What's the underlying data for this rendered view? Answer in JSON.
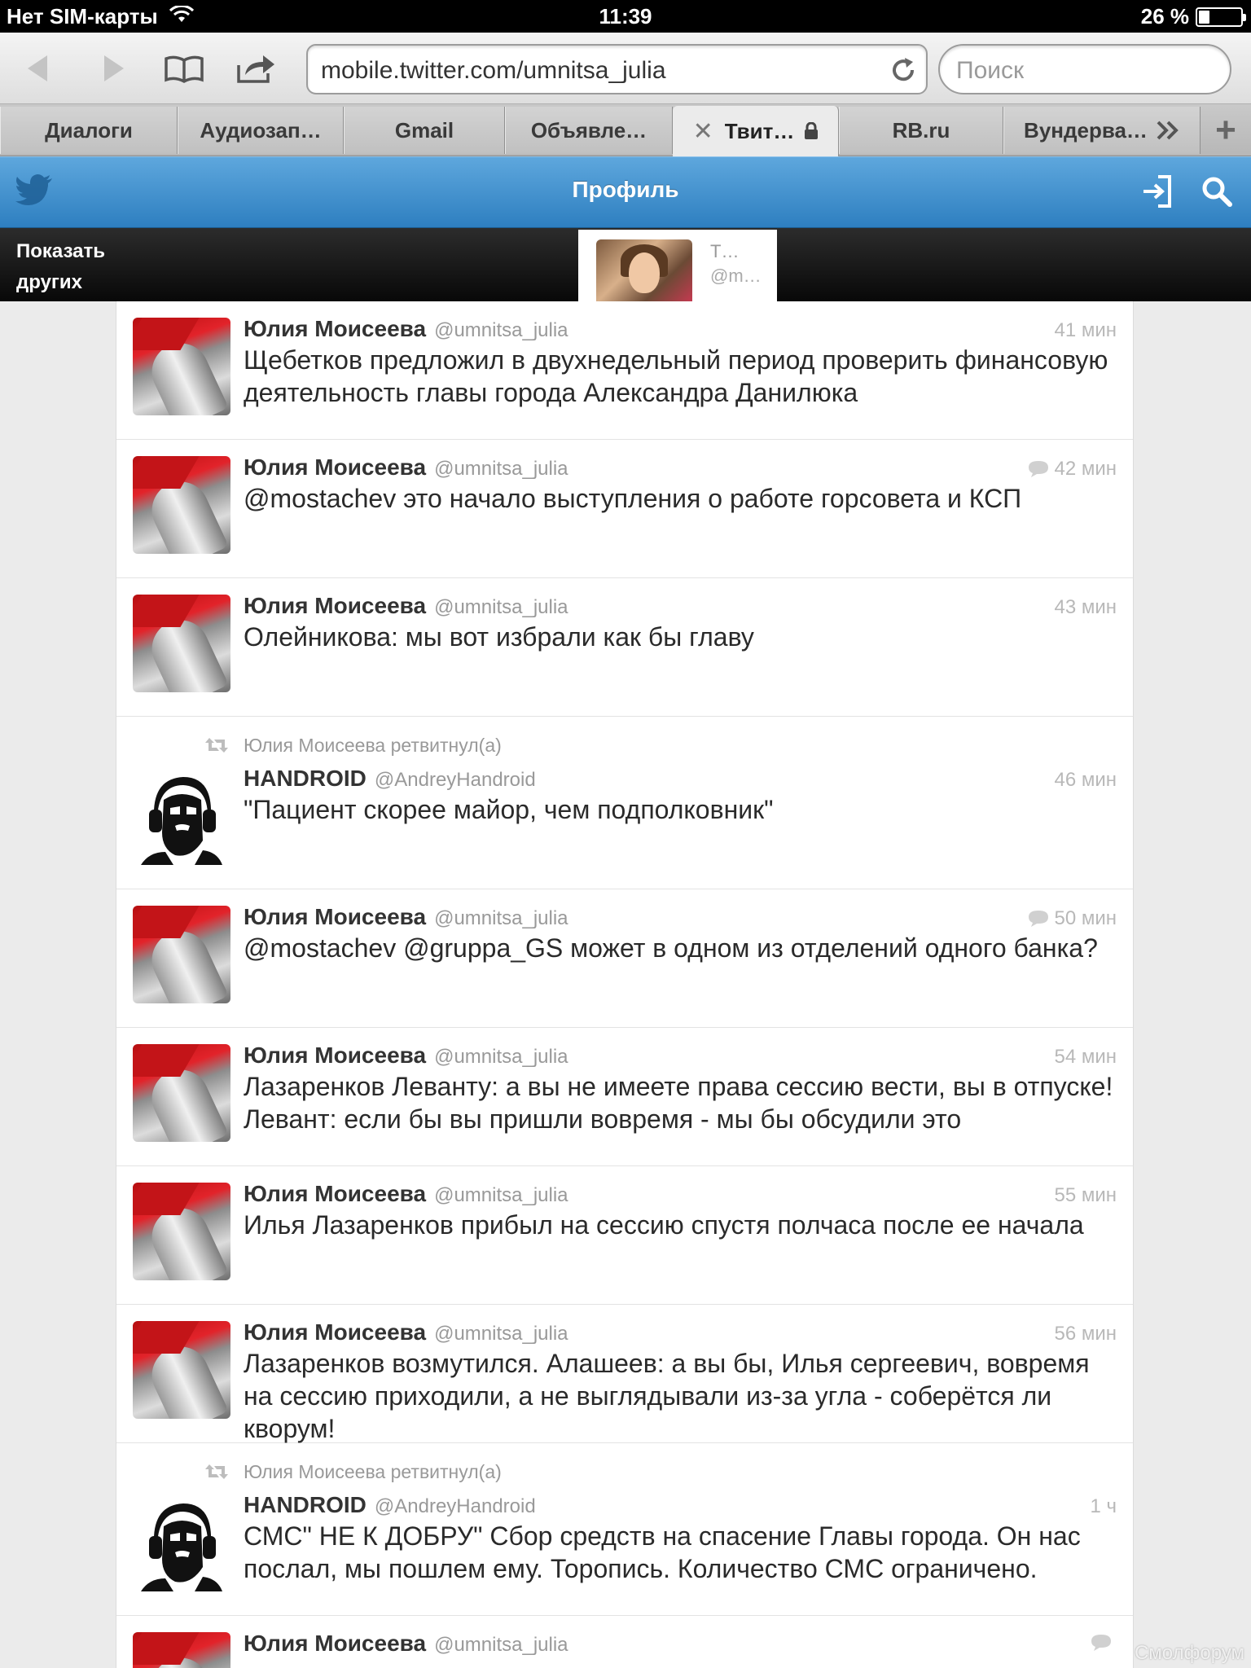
{
  "status_bar": {
    "carrier": "Нет SIM-карты",
    "time": "11:39",
    "battery": "26 %",
    "battery_level": 0.26
  },
  "browser": {
    "url": "mobile.twitter.com/umnitsa_julia",
    "search_placeholder": "Поиск",
    "tabs": [
      "Диалоги",
      "Аудиозап…",
      "Gmail",
      "Объявле…",
      "Твит…",
      "RB.ru",
      "Вундерва…"
    ],
    "active_tab": 4
  },
  "app": {
    "header_title": "Профиль",
    "show_others": "Показать других",
    "profile_card_name": "Т…",
    "profile_card_handle": "@m…"
  },
  "tweets": [
    {
      "name": "Юлия Моисеева",
      "handle": "@umnitsa_julia",
      "time": "41 мин",
      "text": "Щебетков предложил в двухнедельный период проверить финансовую деятельность главы города Александра Данилюка",
      "reply": false
    },
    {
      "name": "Юлия Моисеева",
      "handle": "@umnitsa_julia",
      "time": "42 мин",
      "text": "@mostachev это начало выступления о работе горсовета и КСП",
      "reply": true
    },
    {
      "name": "Юлия Моисеева",
      "handle": "@umnitsa_julia",
      "time": "43 мин",
      "text": "Олейникова: мы вот избрали как бы главу",
      "reply": false
    },
    {
      "retweeted_by": "Юлия Моисеева ретвитнул(а)",
      "name": "HANDROID",
      "handle": "@AndreyHandroid",
      "time": "46 мин",
      "text": "\"Пациент скорее майор, чем подполковник\"",
      "reply": false
    },
    {
      "name": "Юлия Моисеева",
      "handle": "@umnitsa_julia",
      "time": "50 мин",
      "text": "@mostachev @gruppa_GS может в одном из отделений одного банка?",
      "reply": true
    },
    {
      "name": "Юлия Моисеева",
      "handle": "@umnitsa_julia",
      "time": "54 мин",
      "text": "Лазаренков Леванту: а вы не имеете права сессию вести, вы в отпуске! Левант: если бы вы пришли вовремя - мы бы обсудили это",
      "reply": false
    },
    {
      "name": "Юлия Моисеева",
      "handle": "@umnitsa_julia",
      "time": "55 мин",
      "text": "Илья Лазаренков прибыл на сессию спустя полчаса после ее начала",
      "reply": false
    },
    {
      "name": "Юлия Моисеева",
      "handle": "@umnitsa_julia",
      "time": "56 мин",
      "text": "Лазаренков возмутился. Алашеев: а вы бы, Илья сергеевич, вовремя на сессию приходили, а не выглядывали из-за угла - соберётся ли кворум!",
      "reply": false
    },
    {
      "retweeted_by": "Юлия Моисеева ретвитнул(а)",
      "name": "HANDROID",
      "handle": "@AndreyHandroid",
      "time": "1 ч",
      "text": "СМС\" НЕ К ДОБРУ\" Сбор средств на спасение Главы города. Он нас послал, мы пошлем ему. Торопись. Количество СМС ограничено.",
      "reply": false
    },
    {
      "name": "Юлия Моисеева",
      "handle": "@umnitsa_julia",
      "time": "",
      "text": "",
      "reply": true
    }
  ],
  "watermark": "Смолфорум"
}
